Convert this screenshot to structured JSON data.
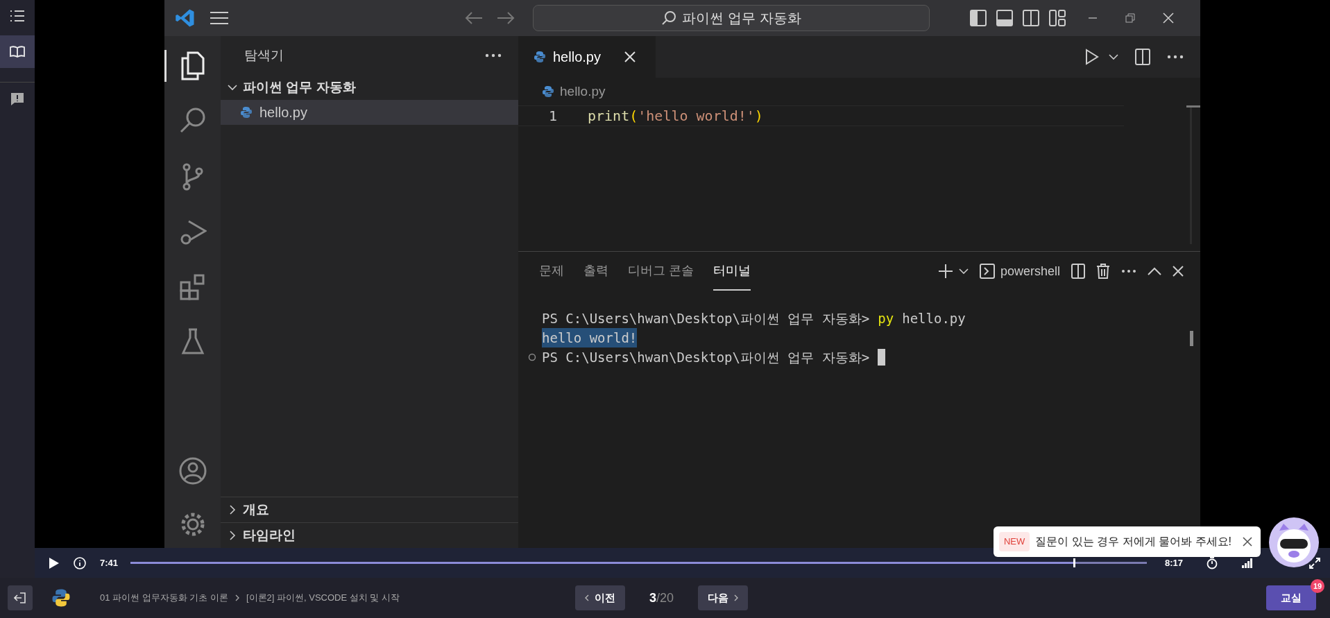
{
  "app_sidebar": {
    "items": [
      {
        "kind": "list",
        "selected": false
      },
      {
        "kind": "book",
        "selected": true
      },
      {
        "kind": "chat",
        "selected": false
      }
    ]
  },
  "vscode": {
    "search": "파이썬 업무 자동화",
    "explorer": {
      "title": "탐색기",
      "folder": {
        "name": "파이썬 업무 자동화",
        "expanded": true,
        "children": [
          {
            "name": "hello.py",
            "selected": true
          }
        ]
      },
      "sections": [
        {
          "name": "개요",
          "expanded": false
        },
        {
          "name": "타임라인",
          "expanded": false
        }
      ]
    },
    "tabs": [
      {
        "label": "hello.py",
        "selected": true
      }
    ],
    "breadcrumb": "hello.py",
    "code": [
      {
        "line": "1",
        "tokens": [
          {
            "kind": "function",
            "text": "print"
          },
          {
            "kind": "bracket",
            "text": "("
          },
          {
            "kind": "string",
            "text": "'hello world!'"
          },
          {
            "kind": "bracket",
            "text": ")"
          }
        ]
      }
    ],
    "panel_tabs": [
      {
        "label": "문제",
        "selected": false
      },
      {
        "label": "출력",
        "selected": false
      },
      {
        "label": "디버그 콘솔",
        "selected": false
      },
      {
        "label": "터미널",
        "selected": true
      }
    ],
    "terminal_shell": "powershell",
    "terminal": [
      {
        "selected": false,
        "segments": [
          {
            "kind": "text",
            "text": "PS C:\\Users\\hwan\\Desktop\\파이썬 업무 자동화>"
          },
          {
            "kind": "command",
            "text": "py"
          },
          {
            "kind": "text",
            "text": "hello.py"
          }
        ]
      },
      {
        "selected": true,
        "segments": [
          {
            "kind": "text",
            "text": "hello world!"
          }
        ]
      },
      {
        "selected": false,
        "decorated": true,
        "cursor": true,
        "segments": [
          {
            "kind": "text",
            "text": "PS C:\\Users\\hwan\\Desktop\\파이썬 업무 자동화>"
          }
        ]
      }
    ]
  },
  "player": {
    "elapsed": "7:41",
    "duration": "8:17",
    "level": 0.928
  },
  "notice": {
    "badge": "NEW",
    "text": "질문이 있는 경우 저에게 물어봐 주세요!"
  },
  "bottom_bar": {
    "breadcrumb": [
      "01 파이썬 업무자동화 기초 이론",
      "[이론2] 파이썬, VSCODE 설치 및 시작"
    ],
    "prev": "이전",
    "page": "3",
    "total": "/20",
    "next": "다음",
    "classroom": "교실",
    "classroom_badge": "19"
  }
}
